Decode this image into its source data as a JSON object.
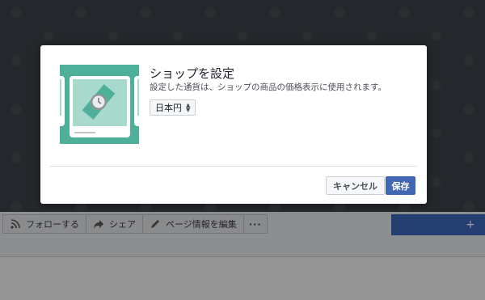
{
  "dialog": {
    "title": "ショップを設定",
    "description": "設定した通貨は、ショップの商品の価格表示に使用されます。",
    "currency_select": {
      "value": "日本円"
    },
    "cancel_label": "キャンセル",
    "save_label": "保存",
    "illustration_icon": "watch-icon"
  },
  "page_actions": {
    "follow_label": "フォローする",
    "share_label": "シェア",
    "edit_label": "ページ情報を編集",
    "more_label": "···"
  },
  "colors": {
    "accent": "#4267b2",
    "illustration_teal": "#4fb09a"
  }
}
